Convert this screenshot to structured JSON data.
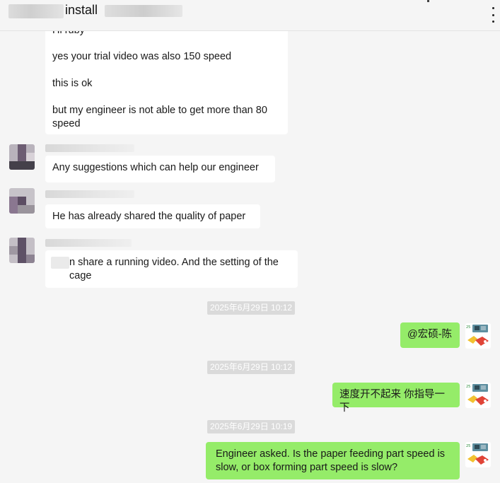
{
  "header": {
    "title": "install"
  },
  "messages": {
    "m1_line0": "Hi ruby",
    "m1_line1": "yes your trial video was also 150 speed",
    "m1_line2": "this is ok",
    "m1_line3": "but my engineer is not able to get more than 80 speed",
    "m2": "Any suggestions which can help our engineer",
    "m3": "He has already shared the quality of paper",
    "m4": "n share a running video.  And the setting of the cage",
    "ts1": "2025年6月29日 10:12",
    "m5": "@宏硕-陈",
    "ts2": "2025年6月29日 10:12",
    "m6": "速度开不起来 你指导一下",
    "ts3": "2025年6月29日 10:19",
    "m7": "Engineer asked. Is the paper feeding part speed is slow, or box forming part speed is slow?"
  },
  "colors": {
    "sent_bubble": "#95ec69",
    "received_bubble": "#ffffff",
    "background": "#f5f5f5",
    "timestamp_bg": "#dadada"
  }
}
